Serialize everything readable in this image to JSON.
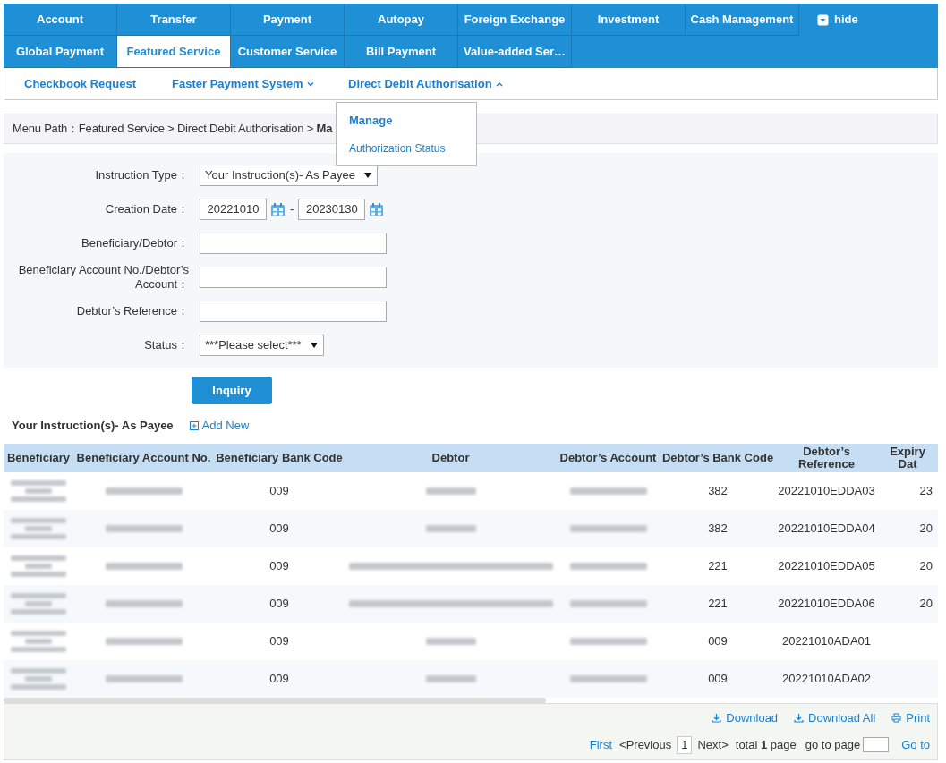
{
  "nav_rows": [
    [
      {
        "label": "Account",
        "selected": false
      },
      {
        "label": "Transfer",
        "selected": false
      },
      {
        "label": "Payment",
        "selected": false
      },
      {
        "label": "Autopay",
        "selected": false
      },
      {
        "label": "Foreign Exchange",
        "selected": false
      },
      {
        "label": "Investment",
        "selected": false
      },
      {
        "label": "Cash Management",
        "selected": false
      }
    ],
    [
      {
        "label": "Global Payment",
        "selected": false
      },
      {
        "label": "Featured Service",
        "selected": true
      },
      {
        "label": "Customer Service",
        "selected": false
      },
      {
        "label": "Bill Payment",
        "selected": false
      },
      {
        "label": "Value-added Ser…",
        "selected": false
      }
    ]
  ],
  "hide_toggle": "hide",
  "sub_nav": [
    {
      "label": "Checkbook Request"
    },
    {
      "label": "Faster Payment System",
      "expanded": false
    },
    {
      "label": "Direct Debit Authorisation",
      "expanded": true
    }
  ],
  "dropdown": [
    {
      "label": "Manage",
      "selected": true
    },
    {
      "label": "Authorization Status",
      "selected": false
    }
  ],
  "breadcrumb": "Menu Path：Featured Service > Direct Debit Authorisation > **Ma**",
  "form": [
    {
      "kind": "select",
      "label": "Instruction Type：",
      "value": "Your Instruction(s)- As Payee"
    },
    {
      "kind": "date_range",
      "label": "Creation Date：",
      "from": "20221010",
      "to": "20230130",
      "separator": "-"
    },
    {
      "kind": "text",
      "label": "Beneficiary/Debtor："
    },
    {
      "kind": "text",
      "label": "Beneficiary Account No./Debtor’s Account："
    },
    {
      "kind": "text",
      "label": "Debtor’s Reference："
    },
    {
      "kind": "select",
      "label": "Status：",
      "value": "***Please select***"
    }
  ],
  "inquiry_button": "Inquiry",
  "results": {
    "title": "Your Instruction(s)- As Payee",
    "add_new": "Add New",
    "columns": [
      "Beneficiary",
      "Beneficiary Account No.",
      "Beneficiary Bank Code",
      "Debtor",
      "Debtor’s Account",
      "Debtor’s Bank Code",
      "Debtor’s Reference",
      "Expiry Dat"
    ],
    "rows": [
      {
        "bank_code": "009",
        "debtor_long": false,
        "debtor_bank_code": "382",
        "reference": "20221010EDDA03",
        "expiry": "23"
      },
      {
        "bank_code": "009",
        "debtor_long": false,
        "debtor_bank_code": "382",
        "reference": "20221010EDDA04",
        "expiry": "20"
      },
      {
        "bank_code": "009",
        "debtor_long": true,
        "debtor_bank_code": "221",
        "reference": "20221010EDDA05",
        "expiry": "20"
      },
      {
        "bank_code": "009",
        "debtor_long": true,
        "debtor_bank_code": "221",
        "reference": "20221010EDDA06",
        "expiry": "20"
      },
      {
        "bank_code": "009",
        "debtor_long": false,
        "debtor_bank_code": "009",
        "reference": "20221010ADA01"
      },
      {
        "bank_code": "009",
        "debtor_long": false,
        "debtor_bank_code": "009",
        "reference": "20221010ADA02"
      }
    ]
  },
  "actions": [
    "Download",
    "Download All",
    "Print"
  ],
  "pagination": {
    "first": "First",
    "previous": "<Previous",
    "page": "1",
    "next": "Next>",
    "total": "total **1** page",
    "go_label": "go to page",
    "go": "Go to"
  }
}
